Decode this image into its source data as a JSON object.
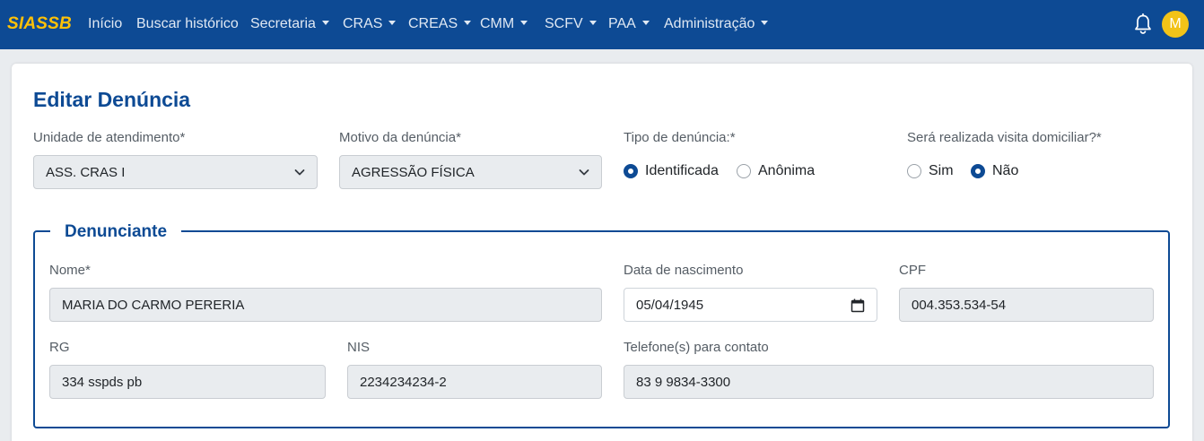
{
  "navbar": {
    "brand": "SIASSB",
    "items": [
      {
        "label": "Início"
      },
      {
        "label": "Buscar histórico"
      },
      {
        "label": "Secretaria"
      },
      {
        "label": "CRAS"
      },
      {
        "label": "CREAS"
      },
      {
        "label": "CMM"
      },
      {
        "label": "SCFV"
      },
      {
        "label": "PAA"
      },
      {
        "label": "Administração"
      }
    ],
    "avatar_initial": "M",
    "bell_icon": "bell-icon"
  },
  "colors": {
    "primary": "#0d4a94",
    "brand_accent": "#ffc107",
    "avatar_bg": "#f2c318"
  },
  "form": {
    "title": "Editar Denúncia",
    "unidade": {
      "label": "Unidade de atendimento*",
      "value": "ASS. CRAS I"
    },
    "motivo": {
      "label": "Motivo da denúncia*",
      "value": "AGRESSÃO FÍSICA"
    },
    "tipo": {
      "label": "Tipo de denúncia:*",
      "options": [
        {
          "label": "Identificada",
          "checked": true
        },
        {
          "label": "Anônima",
          "checked": false
        }
      ]
    },
    "visita": {
      "label": "Será realizada visita domiciliar?*",
      "options": [
        {
          "label": "Sim",
          "checked": false
        },
        {
          "label": "Não",
          "checked": true
        }
      ]
    }
  },
  "denunciante": {
    "legend": "Denunciante",
    "nome": {
      "label": "Nome*",
      "value": "MARIA DO CARMO PERERIA"
    },
    "nascimento": {
      "label": "Data de nascimento",
      "value": "05/04/1945"
    },
    "cpf": {
      "label": "CPF",
      "value": "004.353.534-54"
    },
    "rg": {
      "label": "RG",
      "value": "334 sspds pb"
    },
    "nis": {
      "label": "NIS",
      "value": "2234234234-2"
    },
    "telefone": {
      "label": "Telefone(s) para contato",
      "value": "83 9 9834-3300"
    }
  }
}
